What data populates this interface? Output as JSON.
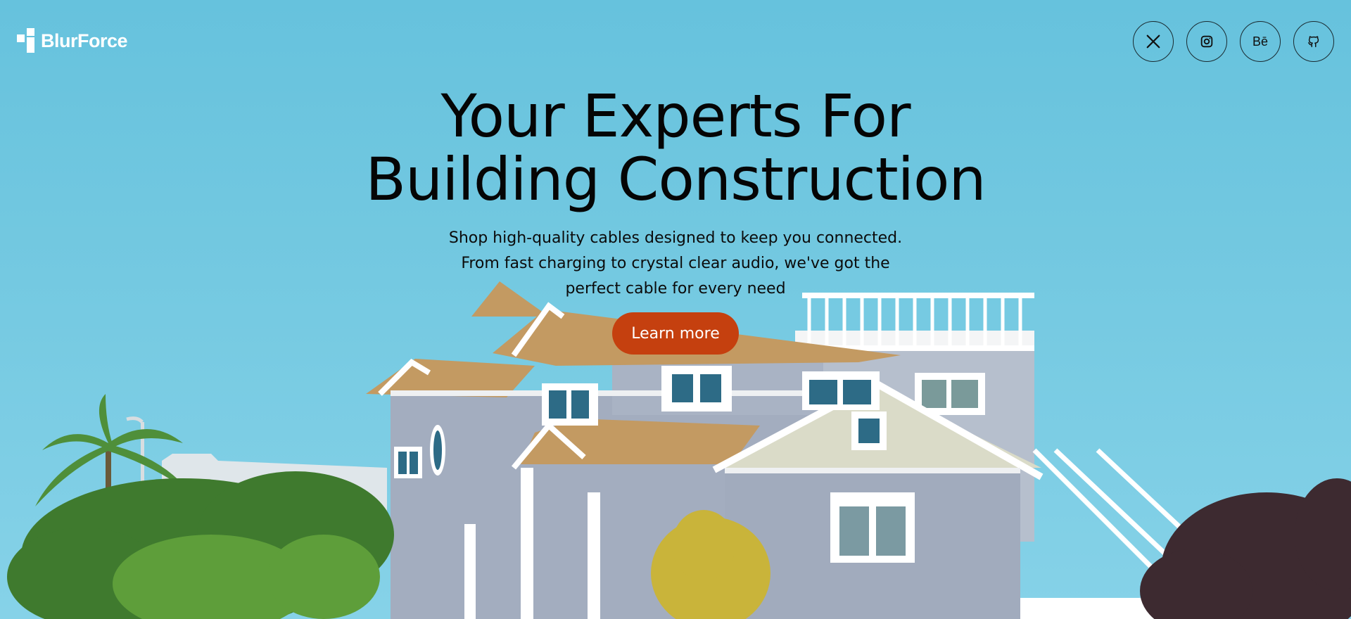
{
  "brand": {
    "name": "BlurForce"
  },
  "social": [
    {
      "name": "x",
      "icon": "x-icon"
    },
    {
      "name": "instagram",
      "icon": "instagram-icon"
    },
    {
      "name": "behance",
      "icon": "behance-icon",
      "label": "Bē"
    },
    {
      "name": "github",
      "icon": "github-icon"
    }
  ],
  "hero": {
    "title_line1": "Your Experts For",
    "title_line2": "Building Construction",
    "subtitle_line1": "Shop high-quality cables designed to keep you connected.",
    "subtitle_line2": "From fast charging to crystal clear audio, we've got the",
    "subtitle_line3": "perfect cable for every need",
    "cta_label": "Learn more"
  },
  "colors": {
    "sky": "#6fc6df",
    "cta": "#c5400f",
    "text": "#050505",
    "logo": "#ffffff"
  }
}
